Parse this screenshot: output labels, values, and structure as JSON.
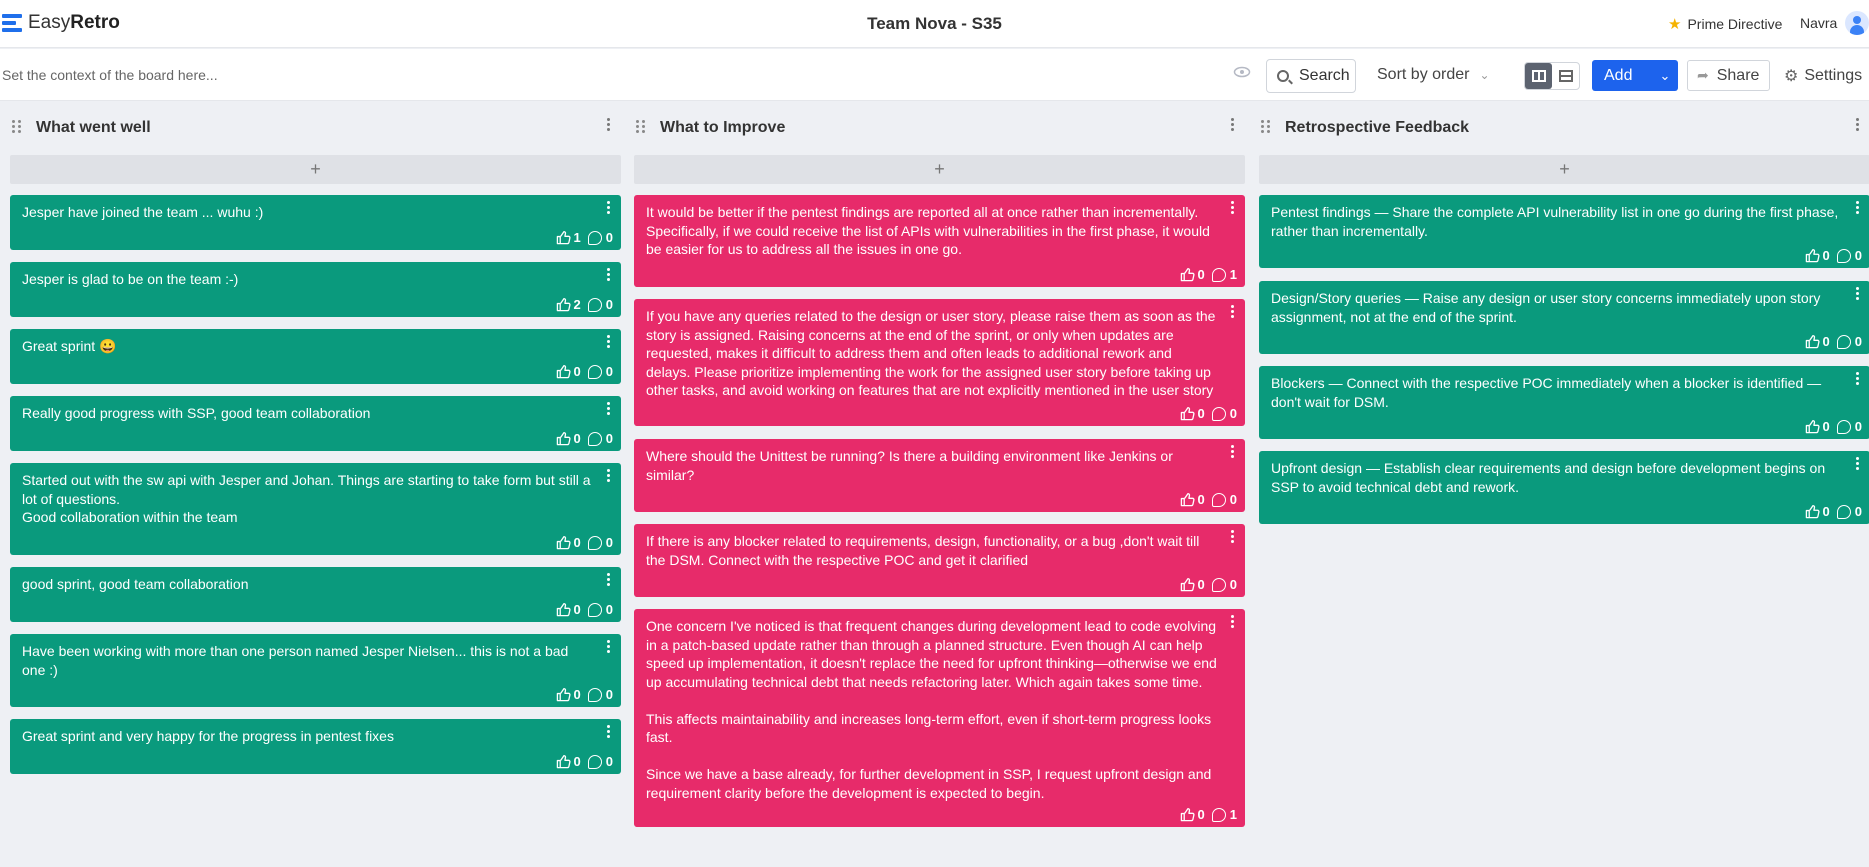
{
  "app": {
    "logo_light": "Easy",
    "logo_bold": "Retro"
  },
  "board": {
    "title": "Team Nova - S35"
  },
  "header": {
    "prime_directive": "Prime Directive",
    "user_name": "Navra"
  },
  "toolbar": {
    "context_placeholder": "Set the context of the board here...",
    "search_label": "Search",
    "sort_label": "Sort by order",
    "add_label": "Add",
    "share_label": "Share",
    "settings_label": "Settings"
  },
  "colors": {
    "green_card": "#0a9a7d",
    "pink_card": "#e72b6a",
    "primary": "#1d63ed"
  },
  "columns": [
    {
      "title": "What went well",
      "add_symbol": "+",
      "cards": [
        {
          "text": "Jesper have joined the team ... wuhu :)",
          "likes": "1",
          "comments": "0"
        },
        {
          "text": "Jesper is glad to be on the team :-)",
          "likes": "2",
          "comments": "0"
        },
        {
          "text": "Great sprint 😀",
          "likes": "0",
          "comments": "0"
        },
        {
          "text": "Really good progress with SSP, good team collaboration",
          "likes": "0",
          "comments": "0"
        },
        {
          "text": "Started out with the sw api with Jesper and Johan. Things are starting to take form but still a lot of questions.\nGood collaboration within the team",
          "likes": "0",
          "comments": "0"
        },
        {
          "text": "good sprint, good team collaboration",
          "likes": "0",
          "comments": "0"
        },
        {
          "text": "Have been working with more than one person named Jesper Nielsen... this is not a bad one :)",
          "likes": "0",
          "comments": "0"
        },
        {
          "text": "Great sprint and very happy for the progress in pentest fixes",
          "likes": "0",
          "comments": "0"
        }
      ]
    },
    {
      "title": "What to Improve",
      "add_symbol": "+",
      "cards": [
        {
          "text": "It would be better if the pentest findings are reported all at once rather than incrementally. Specifically, if we could receive the list of APIs with vulnerabilities in the first phase, it would be easier for us to address all the issues in one go.",
          "likes": "0",
          "comments": "1"
        },
        {
          "text": "If you have any queries related to the design or user story, please raise them as soon as the story is assigned. Raising concerns at the end of the sprint, or only when updates are requested, makes it difficult to address them and often leads to additional rework and delays. Please prioritize implementing the work for the assigned user story before taking up other tasks, and avoid working on features that are not explicitly mentioned in the user story",
          "likes": "0",
          "comments": "0"
        },
        {
          "text": "Where should the Unittest be running? Is there a building environment like Jenkins or similar?",
          "likes": "0",
          "comments": "0"
        },
        {
          "text": "If there is any blocker related to requirements, design, functionality, or a bug ,don't wait till the DSM. Connect with the respective POC and get it clarified",
          "likes": "0",
          "comments": "0"
        },
        {
          "text": "One concern I've noticed is that frequent changes during development lead to code evolving in a patch-based update rather than through a planned structure. Even though AI can help speed up implementation, it doesn't replace the need for upfront thinking—otherwise we end up accumulating technical debt that needs refactoring later. Which again takes some time.\n\nThis affects maintainability and increases long-term effort, even if short-term progress looks fast.\n\nSince we have a base already, for further development in SSP, I request upfront design and requirement clarity before the development is expected to begin.",
          "likes": "0",
          "comments": "1"
        }
      ]
    },
    {
      "title": "Retrospective Feedback",
      "add_symbol": "+",
      "cards": [
        {
          "text": "Pentest findings — Share the complete API vulnerability list in one go during the first phase, rather than incrementally.",
          "likes": "0",
          "comments": "0"
        },
        {
          "text": "Design/Story queries — Raise any design or user story concerns immediately upon story assignment, not at the end of the sprint.",
          "likes": "0",
          "comments": "0"
        },
        {
          "text": "Blockers — Connect with the respective POC immediately when a blocker is identified — don't wait for DSM.",
          "likes": "0",
          "comments": "0"
        },
        {
          "text": "Upfront design — Establish clear requirements and design before development begins on SSP to avoid technical debt and rework.",
          "likes": "0",
          "comments": "0"
        }
      ]
    }
  ]
}
